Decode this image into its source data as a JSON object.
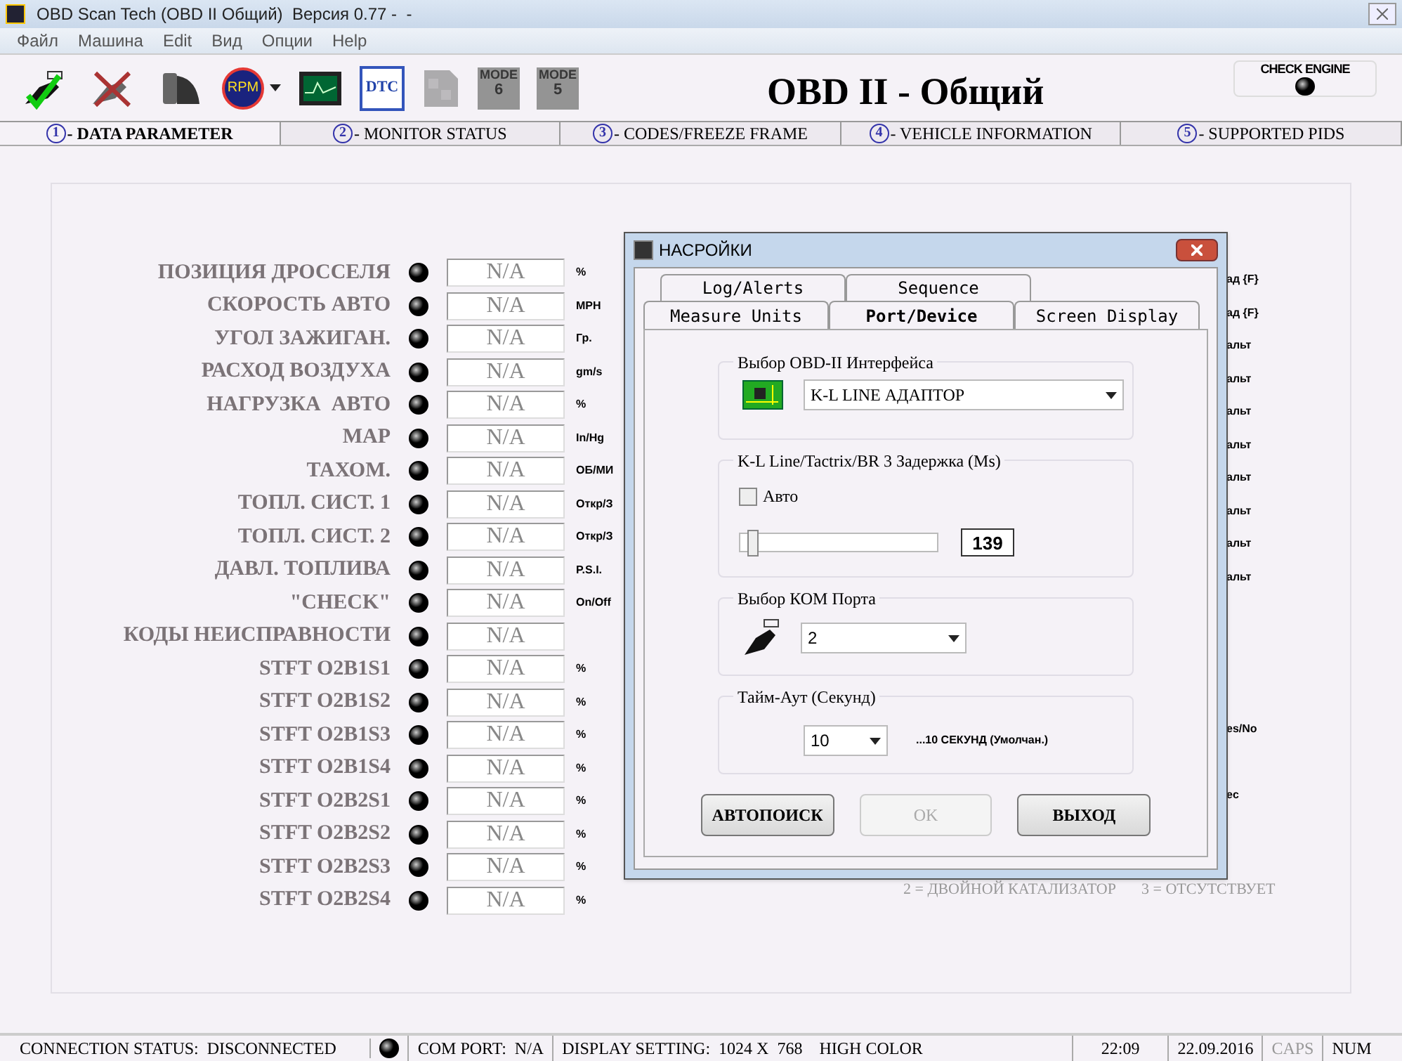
{
  "window": {
    "title": "OBD Scan Tech (OBD II Общий)  Версия 0.77 -  -"
  },
  "menu": [
    "Файл",
    "Машина",
    "Edit",
    "Вид",
    "Опции",
    "Help"
  ],
  "toolbar": [
    {
      "kind": "connect",
      "disabled": false
    },
    {
      "kind": "disconnect",
      "disabled": false
    },
    {
      "kind": "film",
      "disabled": false
    },
    {
      "kind": "rpm",
      "disabled": false,
      "label": "RPM"
    },
    {
      "kind": "scope",
      "disabled": false
    },
    {
      "kind": "dtc",
      "disabled": false,
      "label": "DTC"
    },
    {
      "kind": "sheet",
      "disabled": true
    },
    {
      "kind": "mode",
      "disabled": true,
      "label": "MODE",
      "number": "6"
    },
    {
      "kind": "mode",
      "disabled": true,
      "label": "MODE",
      "number": "5"
    }
  ],
  "header_title": "OBD II - Общий",
  "check_engine": {
    "label": "CHECK ENGINE",
    "on": false
  },
  "tabs": [
    {
      "number": "1",
      "label": "- DATA PARAMETER",
      "selected": true
    },
    {
      "number": "2",
      "label": "- MONITOR STATUS",
      "selected": false
    },
    {
      "number": "3",
      "label": "- CODES/FREEZE FRAME",
      "selected": false
    },
    {
      "number": "4",
      "label": "- VEHICLE INFORMATION",
      "selected": false
    },
    {
      "number": "5",
      "label": "- SUPPORTED PIDS",
      "selected": false
    }
  ],
  "parameters": [
    {
      "label": "ПОЗИЦИЯ ДРОССЕЛЯ",
      "value": "N/A",
      "unit": "%"
    },
    {
      "label": "СКОРОСТЬ АВТО",
      "value": "N/A",
      "unit": "MPH"
    },
    {
      "label": "УГОЛ ЗАЖИГАН.",
      "value": "N/A",
      "unit": "Гр."
    },
    {
      "label": "РАСХОД ВОЗДУХА",
      "value": "N/A",
      "unit": "gm/s"
    },
    {
      "label": "НАГРУЗКА  АВТО",
      "value": "N/A",
      "unit": "%"
    },
    {
      "label": "MAP",
      "value": "N/A",
      "unit": "In/Hg"
    },
    {
      "label": "ТАХОМ.",
      "value": "N/A",
      "unit": "ОБ/МИ"
    },
    {
      "label": "ТОПЛ. СИСТ. 1",
      "value": "N/A",
      "unit": "Откр/З"
    },
    {
      "label": "ТОПЛ. СИСТ. 2",
      "value": "N/A",
      "unit": "Откр/З"
    },
    {
      "label": "ДАВЛ. ТОПЛИВА",
      "value": "N/A",
      "unit": "P.S.I."
    },
    {
      "label": "\"CHECK\"",
      "value": "N/A",
      "unit": "On/Off"
    },
    {
      "label": "КОДЫ НЕИСПРАВНОСТИ",
      "value": "N/A"
    },
    {
      "label": "STFT O2B1S1",
      "value": "N/A",
      "unit": "%"
    },
    {
      "label": "STFT O2B1S2",
      "value": "N/A",
      "unit": "%"
    },
    {
      "label": "STFT O2B1S3",
      "value": "N/A",
      "unit": "%"
    },
    {
      "label": "STFT O2B1S4",
      "value": "N/A",
      "unit": "%"
    },
    {
      "label": "STFT O2B2S1",
      "value": "N/A",
      "unit": "%"
    },
    {
      "label": "STFT O2B2S2",
      "value": "N/A",
      "unit": "%"
    },
    {
      "label": "STFT O2B2S3",
      "value": "N/A",
      "unit": "%"
    },
    {
      "label": "STFT O2B2S4",
      "value": "N/A",
      "unit": "%"
    }
  ],
  "right_column_fragments": [
    "ад {F}",
    "ад {F}",
    "альт",
    "альт",
    "альт",
    "альт",
    "альт",
    "альт",
    "альт",
    "альт"
  ],
  "lower_fragments": [
    "es/No",
    "ec"
  ],
  "legend": [
    "2 = ДВОЙНОЙ КАТАЛИЗАТОР",
    "3 = ОТСУТСТВУЕТ"
  ],
  "dialog": {
    "title": "НАСРОЙКИ",
    "tabs_back": [
      {
        "label": "Log/Alerts",
        "selected": false
      },
      {
        "label": "Sequence",
        "selected": false
      }
    ],
    "tabs_front": [
      {
        "label": "Measure Units",
        "selected": false
      },
      {
        "label": "Port/Device",
        "selected": true
      },
      {
        "label": "Screen Display",
        "selected": false
      }
    ],
    "interface_group": {
      "title": "Выбор OBD-II Интерфейса",
      "value": "K-L LINE АДАПТОР"
    },
    "delay_group": {
      "title": "K-L Line/Tactrix/BR 3 Задержка (Ms)",
      "auto_label": "Авто",
      "auto_checked": false,
      "level": 0.04,
      "value": "139"
    },
    "port_group": {
      "title": "Выбор КОМ Порта",
      "value": "2"
    },
    "timeout_group": {
      "title": "Тайм-Аут (Секунд)",
      "value": "10",
      "hint": "...10 СЕКУНД (Умолчан.)"
    },
    "buttons": [
      {
        "label": "АВТОПОИСК",
        "disabled": false
      },
      {
        "label": "OK",
        "disabled": true
      },
      {
        "label": "ВЫХОД",
        "disabled": false
      }
    ]
  },
  "status_bar": [
    {
      "text": "CONNECTION STATUS:  DISCONNECTED"
    },
    {
      "kind": "led"
    },
    {
      "text": "COM PORT:  N/A"
    },
    {
      "text": "DISPLAY SETTING:  1024 X  768    HIGH COLOR"
    },
    {
      "text": "22:09"
    },
    {
      "text": "22.09.2016"
    },
    {
      "text": "CAPS",
      "disabled": true
    },
    {
      "text": "NUM",
      "disabled": false
    }
  ]
}
